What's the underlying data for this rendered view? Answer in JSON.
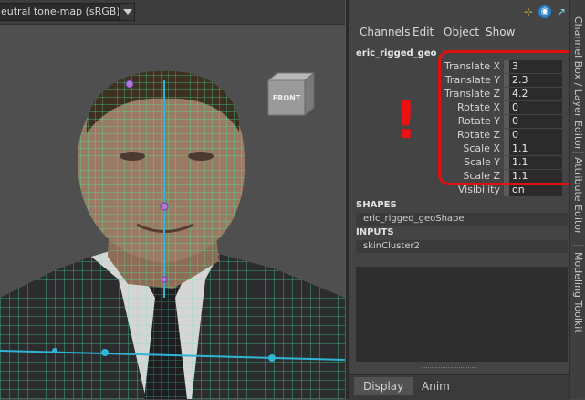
{
  "viewport": {
    "colorspace": "eutral tone-map (sRGB)",
    "viewcube_label": "FRONT"
  },
  "panel": {
    "menus": [
      "Channels",
      "Edit",
      "Object",
      "Show"
    ],
    "object_name": "eric_rigged_geo",
    "attributes": [
      {
        "label": "Translate X",
        "value": "3"
      },
      {
        "label": "Translate Y",
        "value": "2.3"
      },
      {
        "label": "Translate Z",
        "value": "4.2"
      },
      {
        "label": "Rotate X",
        "value": "0"
      },
      {
        "label": "Rotate Y",
        "value": "0"
      },
      {
        "label": "Rotate Z",
        "value": "0"
      },
      {
        "label": "Scale X",
        "value": "1.1"
      },
      {
        "label": "Scale Y",
        "value": "1.1"
      },
      {
        "label": "Scale Z",
        "value": "1.1"
      },
      {
        "label": "Visibility",
        "value": "on"
      }
    ],
    "warning_mark": "!",
    "shapes_label": "SHAPES",
    "shape_item": "eric_rigged_geoShape",
    "inputs_label": "INPUTS",
    "input_item": "skinCluster2",
    "bottom_tabs": [
      "Display",
      "Anim"
    ]
  },
  "side_tabs": [
    "Channel Box / Layer Editor",
    "Attribute Editor",
    "Modeling Toolkit"
  ],
  "colors": {
    "highlight": "#e01010",
    "wireframe": "#3ff0a8",
    "joint": "#2fb4d6",
    "skin": "#9a7a62"
  },
  "icons": {
    "panel": [
      "axis-icon",
      "shield-icon",
      "expand-icon"
    ],
    "dropdown": "chevron-down-icon"
  }
}
